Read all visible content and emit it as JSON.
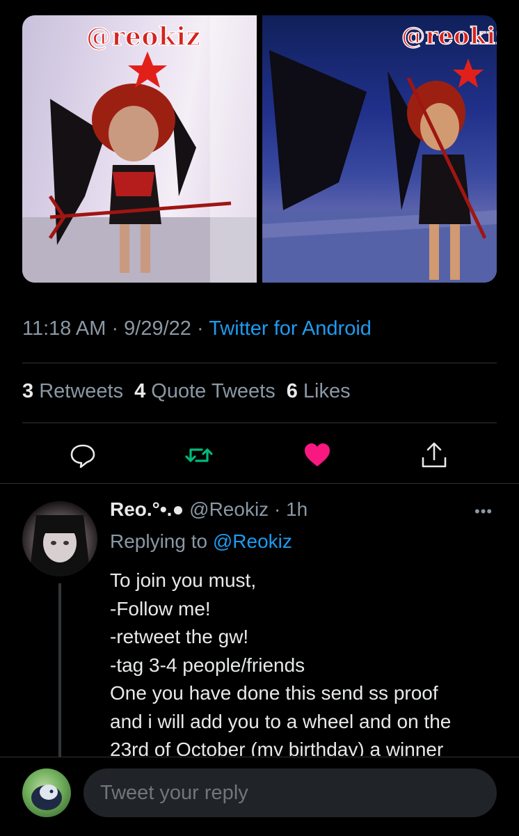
{
  "media": {
    "left_watermark": "@reokiz",
    "right_watermark": "@reokiz"
  },
  "meta": {
    "time": "11:18 AM",
    "sep1": " · ",
    "date": "9/29/22",
    "sep2": " · ",
    "source": "Twitter for Android"
  },
  "stats": {
    "retweets_count": "3",
    "retweets_label": "Retweets",
    "quotes_count": "4",
    "quotes_label": "Quote Tweets",
    "likes_count": "6",
    "likes_label": "Likes"
  },
  "actions": {
    "reply_icon": "speech-bubble-icon",
    "retweet_icon": "retweet-arrows-icon",
    "like_icon": "heart-filled-icon",
    "share_icon": "share-upload-icon",
    "retweet_color": "#00ba7c",
    "like_color": "#f91880"
  },
  "reply": {
    "display_name": "Reo.°•.●",
    "handle_time": "@Reokiz · 1h",
    "more": "•••",
    "replying_prefix": "Replying to ",
    "replying_to": "@Reokiz",
    "lines": [
      "To join you must,",
      "-Follow me!",
      "-retweet the gw!",
      "-tag 3-4 people/friends",
      "One you have done this send ss proof",
      "and i will add you to a wheel and on the",
      "23rd of October (my birthday) a winner"
    ]
  },
  "compose": {
    "placeholder": "Tweet your reply"
  },
  "colors": {
    "background": "#000000",
    "accent": "#1d9bf0",
    "muted": "#8b98a5",
    "divider": "#2f3336"
  }
}
